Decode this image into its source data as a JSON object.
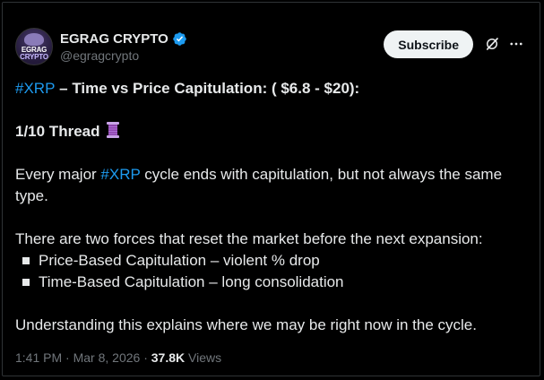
{
  "author": {
    "display_name": "EGRAG CRYPTO",
    "handle": "@egragcrypto",
    "avatar_text_top": "EGRAG",
    "avatar_text_bottom": "CRYPTO",
    "verified_icon": "verified-badge-icon",
    "verified_color": "#1d9bf0"
  },
  "actions": {
    "subscribe_label": "Subscribe",
    "grok_icon": "grok-icon",
    "more_icon": "more-icon"
  },
  "post": {
    "title_hashtag": "#XRP",
    "title_rest": " – Time vs Price Capitulation: ( $6.8 - $20):",
    "thread_label": "1/10 Thread",
    "thread_icon": "thread-spool-emoji",
    "para1_start": "Every major ",
    "para1_hashtag": "#XRP",
    "para1_end": " cycle ends with capitulation, but not always the same type.",
    "para2": "There are two forces that reset the market before the next expansion:",
    "bullets": [
      "Price-Based Capitulation – violent % drop",
      "Time-Based Capitulation – long consolidation"
    ],
    "para3": "Understanding this explains where we may be right now in the cycle."
  },
  "meta": {
    "time": "1:41 PM",
    "separator": " · ",
    "date": "Mar 8, 2026",
    "views_count": "37.8K",
    "views_label": " Views"
  },
  "colors": {
    "background": "#000000",
    "text": "#e7e9ea",
    "muted": "#71767b",
    "link": "#1d9bf0"
  }
}
